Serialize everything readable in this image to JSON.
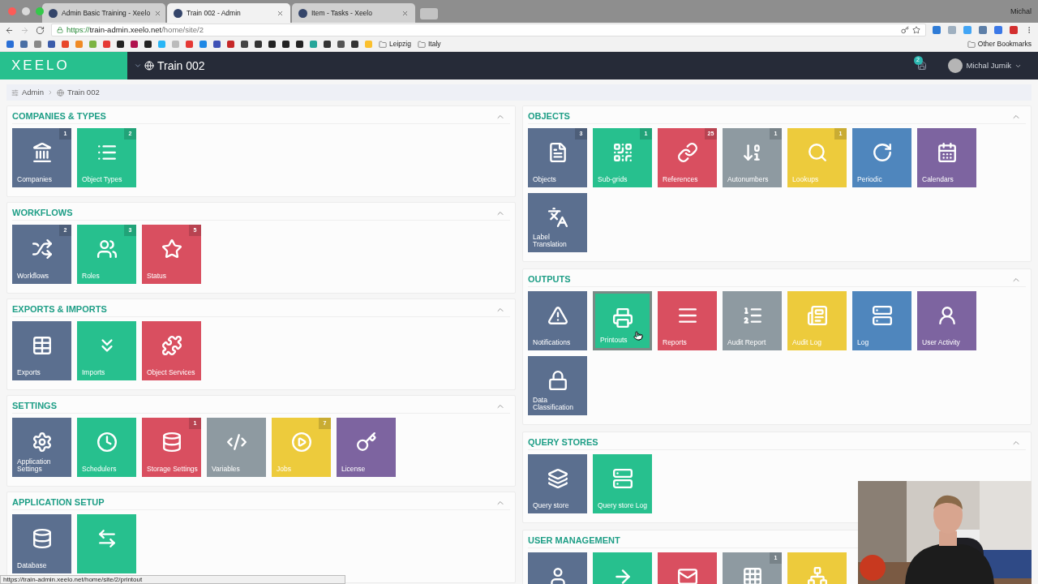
{
  "browser": {
    "tabs": [
      {
        "title": "Admin Basic Training - Xeelo",
        "selected": false
      },
      {
        "title": "Train 002 - Admin",
        "selected": true
      },
      {
        "title": "Item - Tasks - Xeelo",
        "selected": false
      }
    ],
    "profile": "Michal",
    "url": {
      "scheme": "https://",
      "host": "train-admin.xeelo.net",
      "path": "/home/site/2"
    },
    "bookmark_folders": [
      "Leipzig",
      "Italy"
    ],
    "other_bookmarks": "Other Bookmarks",
    "status_url": "https://train-admin.xeelo.net/home/site/2/printout"
  },
  "header": {
    "logo": "XEELO",
    "site": "Train 002",
    "notification_count": "2",
    "user": "Michal Jurnik"
  },
  "breadcrumb": [
    "Admin",
    "Train 002"
  ],
  "left_sections": [
    {
      "title": "COMPANIES & TYPES",
      "expanded": true,
      "tiles": [
        {
          "label": "Companies",
          "color": "#5b6f8f",
          "badge": "1",
          "hovered": false
        },
        {
          "label": "Object Types",
          "color": "#27c08e",
          "badge": "2",
          "hovered": false
        }
      ]
    },
    {
      "title": "WORKFLOWS",
      "expanded": true,
      "tiles": [
        {
          "label": "Workflows",
          "color": "#5b6f8f",
          "badge": "2",
          "hovered": false
        },
        {
          "label": "Roles",
          "color": "#27c08e",
          "badge": "3",
          "hovered": false
        },
        {
          "label": "Status",
          "color": "#d94f60",
          "badge": "5",
          "hovered": false
        }
      ]
    },
    {
      "title": "EXPORTS & IMPORTS",
      "expanded": true,
      "tiles": [
        {
          "label": "Exports",
          "color": "#5b6f8f",
          "hovered": false
        },
        {
          "label": "Imports",
          "color": "#27c08e",
          "hovered": false
        },
        {
          "label": "Object Services",
          "color": "#d94f60",
          "hovered": false
        }
      ]
    },
    {
      "title": "SETTINGS",
      "expanded": true,
      "tiles": [
        {
          "label": "Application Settings",
          "color": "#5b6f8f",
          "hovered": false
        },
        {
          "label": "Schedulers",
          "color": "#27c08e",
          "hovered": false
        },
        {
          "label": "Storage Settings",
          "color": "#d94f60",
          "badge": "1",
          "hovered": false
        },
        {
          "label": "Variables",
          "color": "#8e9aa1",
          "hovered": false
        },
        {
          "label": "Jobs",
          "color": "#edcb3c",
          "badge": "7",
          "hovered": false
        },
        {
          "label": "License",
          "color": "#7d64a0",
          "hovered": false
        }
      ]
    },
    {
      "title": "APPLICATION SETUP",
      "expanded": true,
      "tiles": [
        {
          "label": "Database",
          "color": "#5b6f8f",
          "hovered": false
        },
        {
          "color": "#27c08e",
          "hovered": false
        }
      ]
    }
  ],
  "right_sections": [
    {
      "title": "OBJECTS",
      "expanded": true,
      "tiles": [
        {
          "label": "Objects",
          "color": "#5b6f8f",
          "badge": "3",
          "hovered": false
        },
        {
          "label": "Sub-grids",
          "color": "#27c08e",
          "badge": "1",
          "hovered": false
        },
        {
          "label": "References",
          "color": "#d94f60",
          "badge": "25",
          "hovered": false
        },
        {
          "label": "Autonumbers",
          "color": "#8e9aa1",
          "badge": "1",
          "hovered": false
        },
        {
          "label": "Lookups",
          "color": "#edcb3c",
          "badge": "1",
          "hovered": false
        },
        {
          "label": "Periodic",
          "color": "#4f86bd",
          "hovered": false
        },
        {
          "label": "Calendars",
          "color": "#7d64a0",
          "hovered": false
        },
        {
          "label": "Label Translation",
          "color": "#5b6f8f",
          "hovered": false
        }
      ]
    },
    {
      "title": "OUTPUTS",
      "expanded": true,
      "tiles": [
        {
          "label": "Notifications",
          "color": "#5b6f8f",
          "hovered": false
        },
        {
          "label": "Printouts",
          "color": "#27c08e",
          "hovered": true
        },
        {
          "label": "Reports",
          "color": "#d94f60",
          "hovered": false
        },
        {
          "label": "Audit Report",
          "color": "#8e9aa1",
          "hovered": false
        },
        {
          "label": "Audit Log",
          "color": "#edcb3c",
          "hovered": false
        },
        {
          "label": "Log",
          "color": "#4f86bd",
          "hovered": false
        },
        {
          "label": "User Activity",
          "color": "#7d64a0",
          "hovered": false
        },
        {
          "label": "Data Classification",
          "color": "#5b6f8f",
          "hovered": false
        }
      ]
    },
    {
      "title": "QUERY STORES",
      "expanded": true,
      "tiles": [
        {
          "label": "Query store",
          "color": "#5b6f8f",
          "hovered": false
        },
        {
          "label": "Query store Log",
          "color": "#27c08e",
          "hovered": false
        }
      ]
    },
    {
      "title": "USER MANAGEMENT",
      "tiles": [
        {
          "color": "#5b6f8f",
          "hovered": false
        },
        {
          "color": "#27c08e",
          "hovered": false
        },
        {
          "color": "#d94f60",
          "hovered": false
        },
        {
          "color": "#8e9aa1",
          "badge": "1",
          "hovered": false
        },
        {
          "color": "#edcb3c",
          "hovered": false
        }
      ]
    }
  ],
  "video": {
    "kind": "picture"
  }
}
